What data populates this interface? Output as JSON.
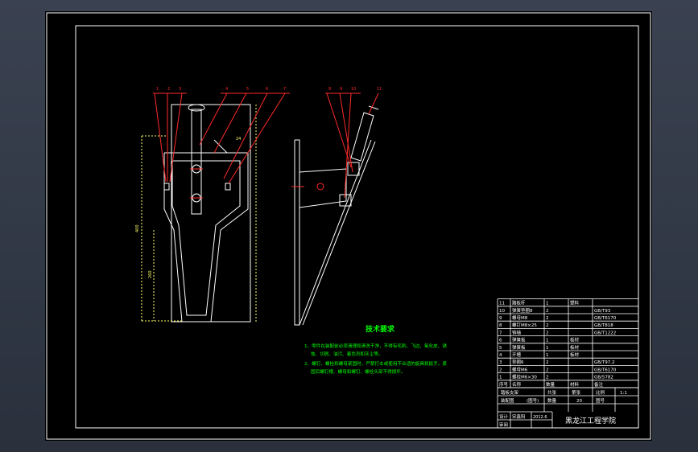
{
  "colors": {
    "background": "#000000",
    "frame": "#ffffff",
    "leader": "#ff2a2a",
    "dimension": "#ffff66",
    "notes": "#00ff00",
    "part": "#ffffff"
  },
  "front_view": {
    "balloons": [
      "1",
      "2",
      "3",
      "4",
      "5",
      "6",
      "7"
    ],
    "dimensions": [
      "24",
      "260",
      "400"
    ]
  },
  "side_view": {
    "balloons": [
      "8",
      "9",
      "10",
      "11"
    ]
  },
  "technical_requirements": {
    "title": "技术要求",
    "lines": [
      "1、零件在装配前必须清理和清洗干净，不得有毛刺、飞边、氧化皮、锈",
      "蚀、切屑、油污、着色剂和灰尘等。",
      "2、螺钉、螺栓和螺母紧固时，严禁打击或使用不合适的旋具和扳手。紧",
      "固后螺钉槽、螺母和螺钉、螺栓头部不得损坏。"
    ]
  },
  "parts_list": {
    "rows": [
      {
        "no": "11",
        "name": "踏板杆",
        "qty": "1",
        "material": "塑料",
        "note": ""
      },
      {
        "no": "10",
        "name": "弹簧垫圈8",
        "qty": "2",
        "material": "",
        "note": "GB/T93"
      },
      {
        "no": "9",
        "name": "螺母M8",
        "qty": "2",
        "material": "",
        "note": "GB/T6170"
      },
      {
        "no": "8",
        "name": "螺钉M8×25",
        "qty": "2",
        "material": "",
        "note": "GB/T818"
      },
      {
        "no": "7",
        "name": "销轴",
        "qty": "2",
        "material": "",
        "note": "GB/T1222"
      },
      {
        "no": "6",
        "name": "弹簧板",
        "qty": "1",
        "material": "板材",
        "note": ""
      },
      {
        "no": "5",
        "name": "弹簧板",
        "qty": "1",
        "material": "板材",
        "note": ""
      },
      {
        "no": "4",
        "name": "开槽",
        "qty": "1",
        "material": "板材",
        "note": ""
      },
      {
        "no": "3",
        "name": "垫圈6",
        "qty": "2",
        "material": "",
        "note": "GB/T97.2"
      },
      {
        "no": "2",
        "name": "螺母M6",
        "qty": "2",
        "material": "",
        "note": "GB/T6170"
      },
      {
        "no": "1",
        "name": "螺栓M6×30",
        "qty": "2",
        "material": "",
        "note": "GB/5782"
      }
    ],
    "header": {
      "no": "序号",
      "name": "名称",
      "qty": "数量",
      "material": "材料",
      "note": "备注"
    }
  },
  "title_block": {
    "drawing_title_1": "踏板支架",
    "drawing_title_2": "装配图",
    "drawing_no_label": "(图号)",
    "weight_label": "共张",
    "sheet_label": "第张",
    "scale_label": "比例",
    "scale_value": "1:1",
    "qty_label": "数量",
    "qty_value": "20",
    "part_no_label": "图号",
    "designer_label": "设计",
    "designer_name": "宋鑫阳",
    "date": "2012.6",
    "reviewer_label": "审阅",
    "school": "黑龙江工程学院"
  }
}
